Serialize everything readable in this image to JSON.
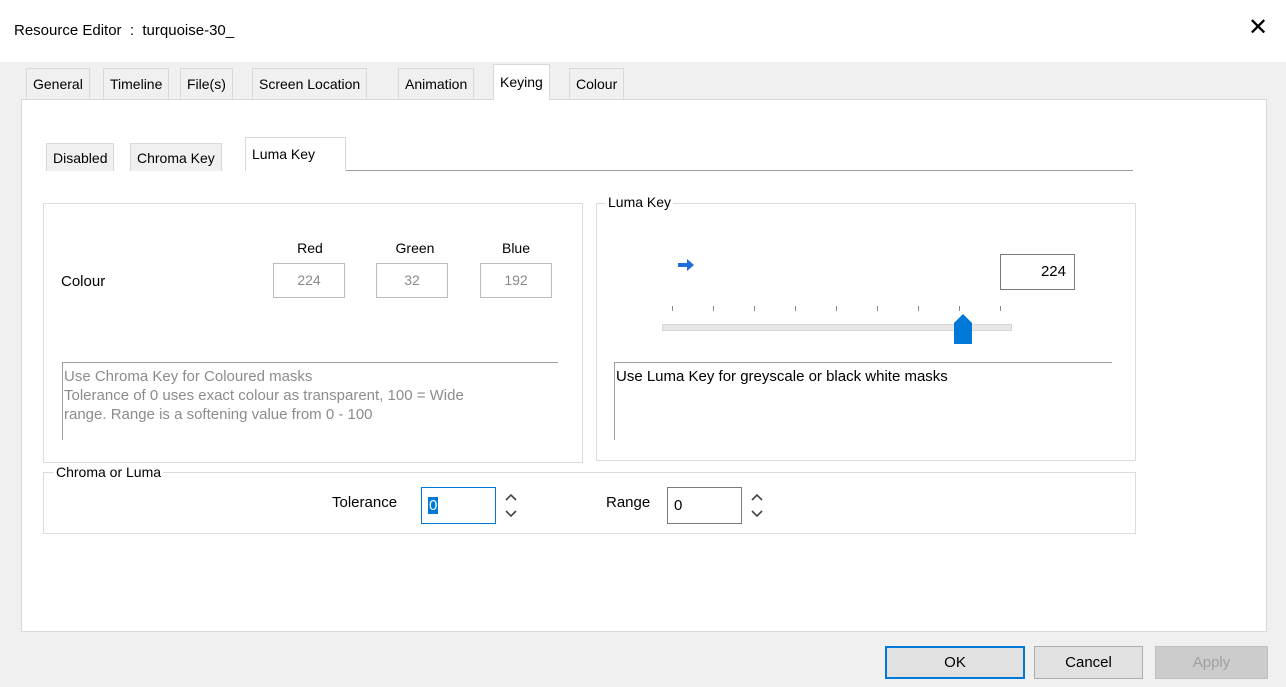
{
  "window": {
    "title": "Resource Editor  :  turquoise-30_",
    "close_glyph": "✕"
  },
  "main_tabs": [
    {
      "label": "General"
    },
    {
      "label": "Timeline"
    },
    {
      "label": "File(s)"
    },
    {
      "label": "Screen Location"
    },
    {
      "label": "Animation"
    },
    {
      "label": "Keying",
      "active": true
    },
    {
      "label": "Colour"
    }
  ],
  "sub_tabs": [
    {
      "label": "Disabled"
    },
    {
      "label": "Chroma Key"
    },
    {
      "label": "Luma Key",
      "active": true
    }
  ],
  "chroma": {
    "colour_label": "Colour",
    "red_label": "Red",
    "green_label": "Green",
    "blue_label": "Blue",
    "red_value": "224",
    "green_value": "32",
    "blue_value": "192",
    "help_line1": "Use Chroma Key for Coloured masks",
    "help_line2": "Tolerance of 0 uses exact colour as transparent, 100 = Wide",
    "help_line3": "range. Range is a softening value from 0 - 100"
  },
  "luma": {
    "group_title": "Luma Key",
    "value": "224",
    "slider_max": 255,
    "help_text": "Use Luma Key for greyscale or black white masks"
  },
  "chroma_or_luma": {
    "group_title": "Chroma or Luma",
    "tolerance_label": "Tolerance",
    "tolerance_value": "0",
    "range_label": "Range",
    "range_value": "0"
  },
  "buttons": {
    "ok": "OK",
    "cancel": "Cancel",
    "apply": "Apply"
  },
  "colors": {
    "accent": "#0078d7",
    "disabled_text": "#8c8c8c"
  },
  "icons": {
    "arrow": "arrow-right-icon",
    "slider": "slider-thumb-icon",
    "spin_up": "chevron-up-icon",
    "spin_down": "chevron-down-icon"
  }
}
